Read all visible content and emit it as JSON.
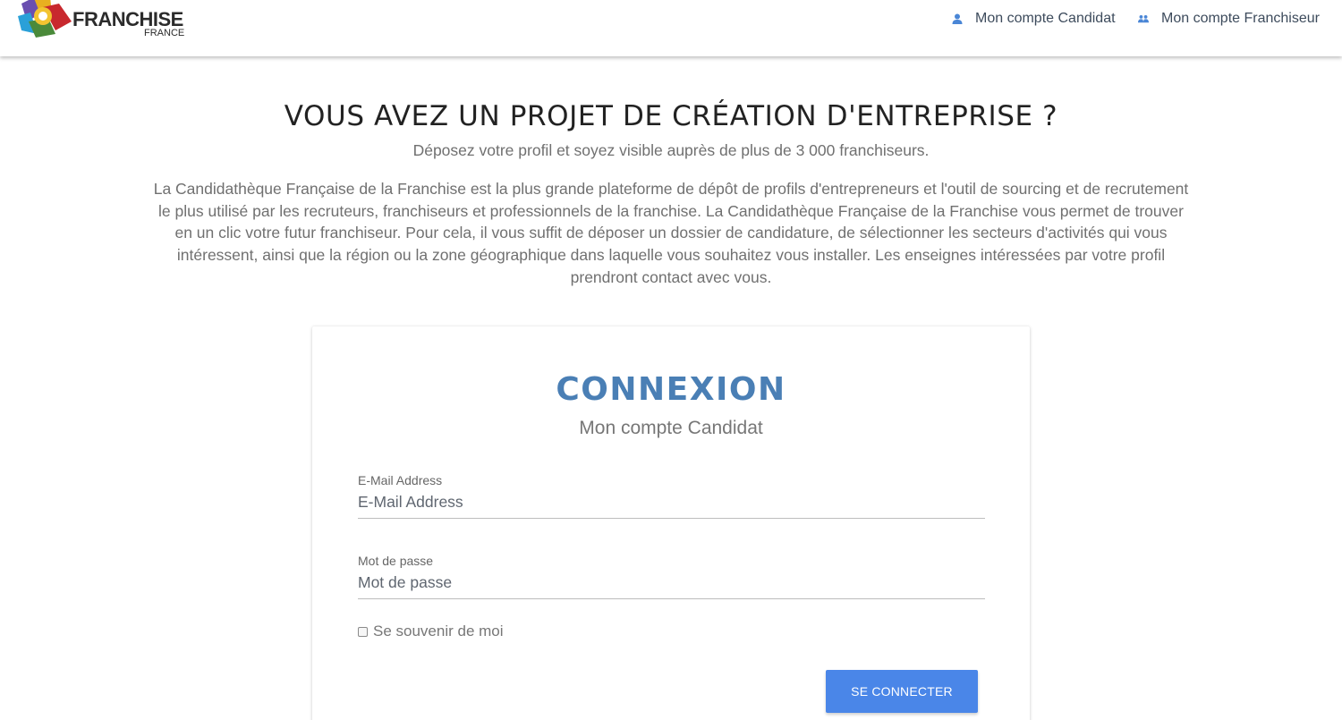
{
  "header": {
    "logo_main": "FRANCHISE",
    "logo_sub": "FRANCE",
    "nav": [
      {
        "label": "Mon compte Candidat",
        "icon": "person-icon"
      },
      {
        "label": "Mon compte Franchiseur",
        "icon": "people-icon"
      }
    ]
  },
  "hero": {
    "title": "VOUS AVEZ UN PROJET DE CRÉATION D'ENTREPRISE ?",
    "subtitle": "Déposez votre profil et soyez visible auprès de plus de 3 000 franchiseurs.",
    "description": "La Candidathèque Française de la Franchise est la plus grande plateforme de dépôt de profils d'entrepreneurs et l'outil de sourcing et de recrutement le plus utilisé par les recruteurs, franchiseurs et professionnels de la franchise. La Candidathèque Française de la Franchise vous permet de trouver en un clic votre futur franchiseur. Pour cela, il vous suffit de déposer un dossier de candidature, de sélectionner les secteurs d'activités qui vous intéressent, ainsi que la région ou la zone géographique dans laquelle vous souhaitez vous installer. Les enseignes intéressées par votre profil prendront contact avec vous."
  },
  "login": {
    "title": "CONNEXION",
    "subtitle": "Mon compte Candidat",
    "email": {
      "label": "E-Mail Address",
      "placeholder": "E-Mail Address",
      "value": ""
    },
    "password": {
      "label": "Mot de passe",
      "placeholder": "Mot de passe",
      "value": ""
    },
    "remember_label": "Se souvenir de moi",
    "remember_checked": false,
    "submit_label": "SE CONNECTER"
  },
  "colors": {
    "accent": "#4a86e8",
    "title_blue": "#4a7fb5",
    "nav_icon": "#4a86d6"
  }
}
